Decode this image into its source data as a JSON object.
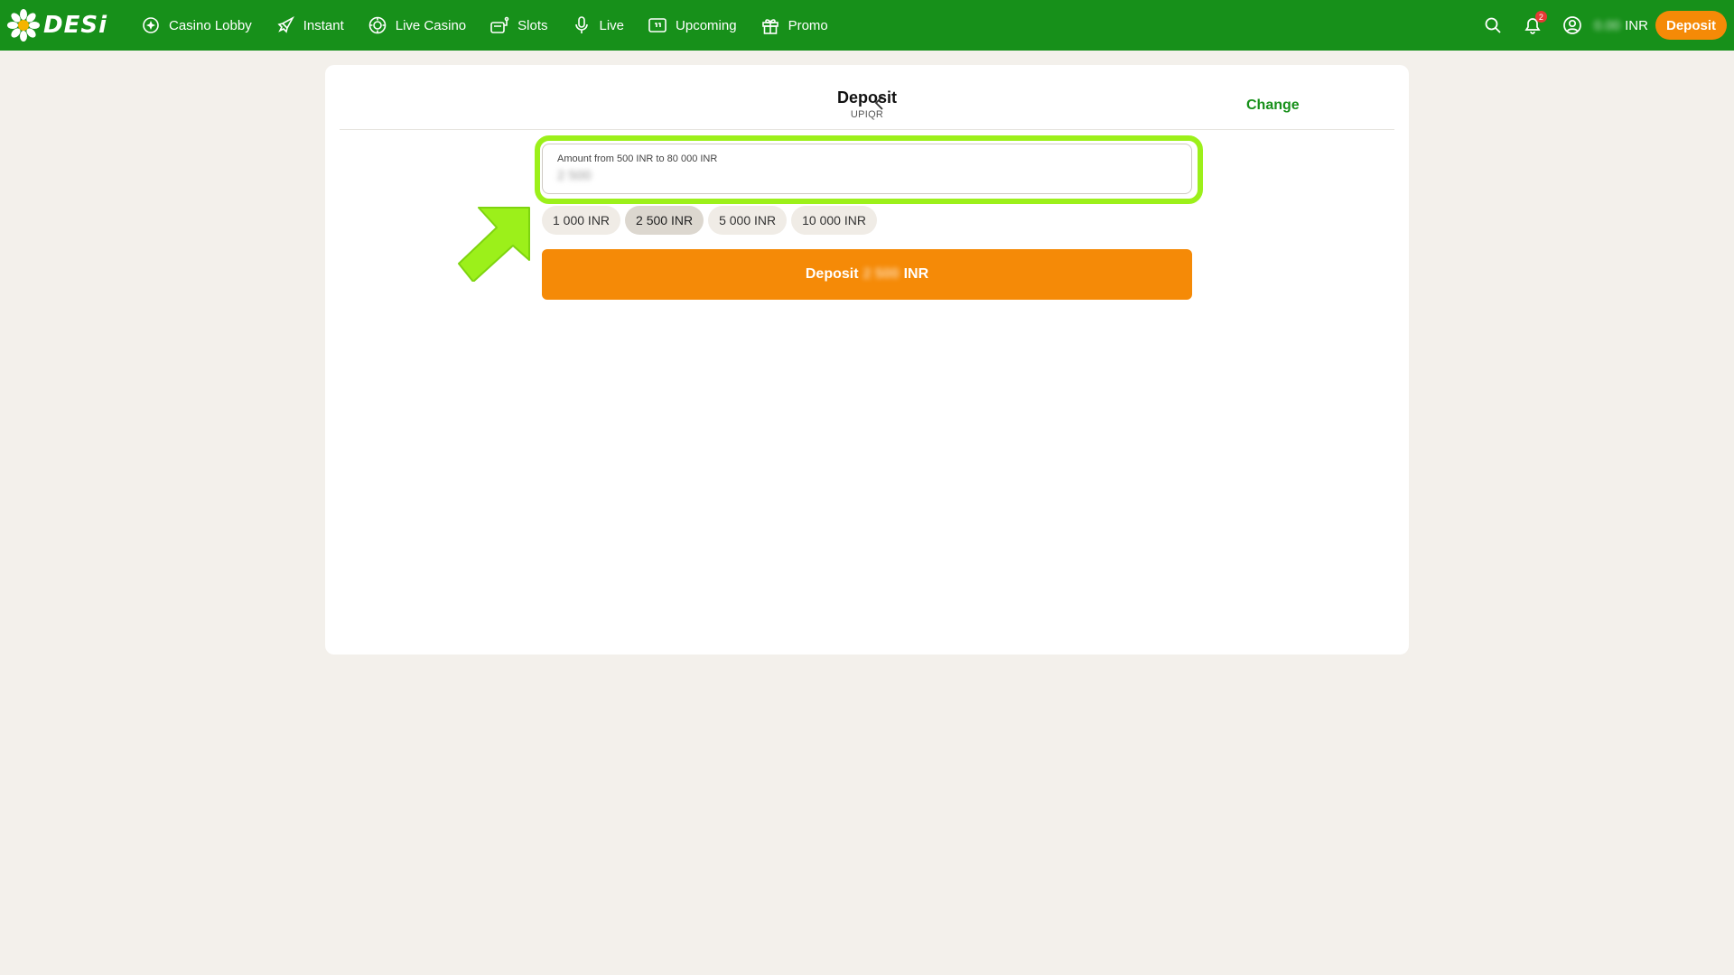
{
  "header": {
    "logo_text": "DESi",
    "nav": [
      {
        "label": "Casino Lobby",
        "icon": "casino-icon"
      },
      {
        "label": "Instant",
        "icon": "rocket-icon"
      },
      {
        "label": "Live Casino",
        "icon": "chip-icon"
      },
      {
        "label": "Slots",
        "icon": "slot-machine-icon"
      },
      {
        "label": "Live",
        "icon": "microphone-icon"
      },
      {
        "label": "Upcoming",
        "icon": "scoreboard-icon"
      },
      {
        "label": "Promo",
        "icon": "gift-icon"
      }
    ],
    "notifications_count": "2",
    "balance_value": "0.00",
    "balance_currency": "INR",
    "deposit_label": "Deposit"
  },
  "deposit": {
    "title": "Deposit",
    "method": "UPIQR",
    "change_label": "Change",
    "amount_label": "Amount from 500 INR to 80 000 INR",
    "amount_value": "2 500",
    "presets": [
      {
        "label": "1 000 INR",
        "selected": false
      },
      {
        "label": "2 500 INR",
        "selected": true
      },
      {
        "label": "5 000 INR",
        "selected": false
      },
      {
        "label": "10 000 INR",
        "selected": false
      }
    ],
    "submit_prefix": "Deposit",
    "submit_amount": "2 500",
    "submit_currency": "INR"
  },
  "colors": {
    "brand_green": "#17901a",
    "accent_orange": "#f58a07",
    "highlight": "#9cf01a"
  }
}
